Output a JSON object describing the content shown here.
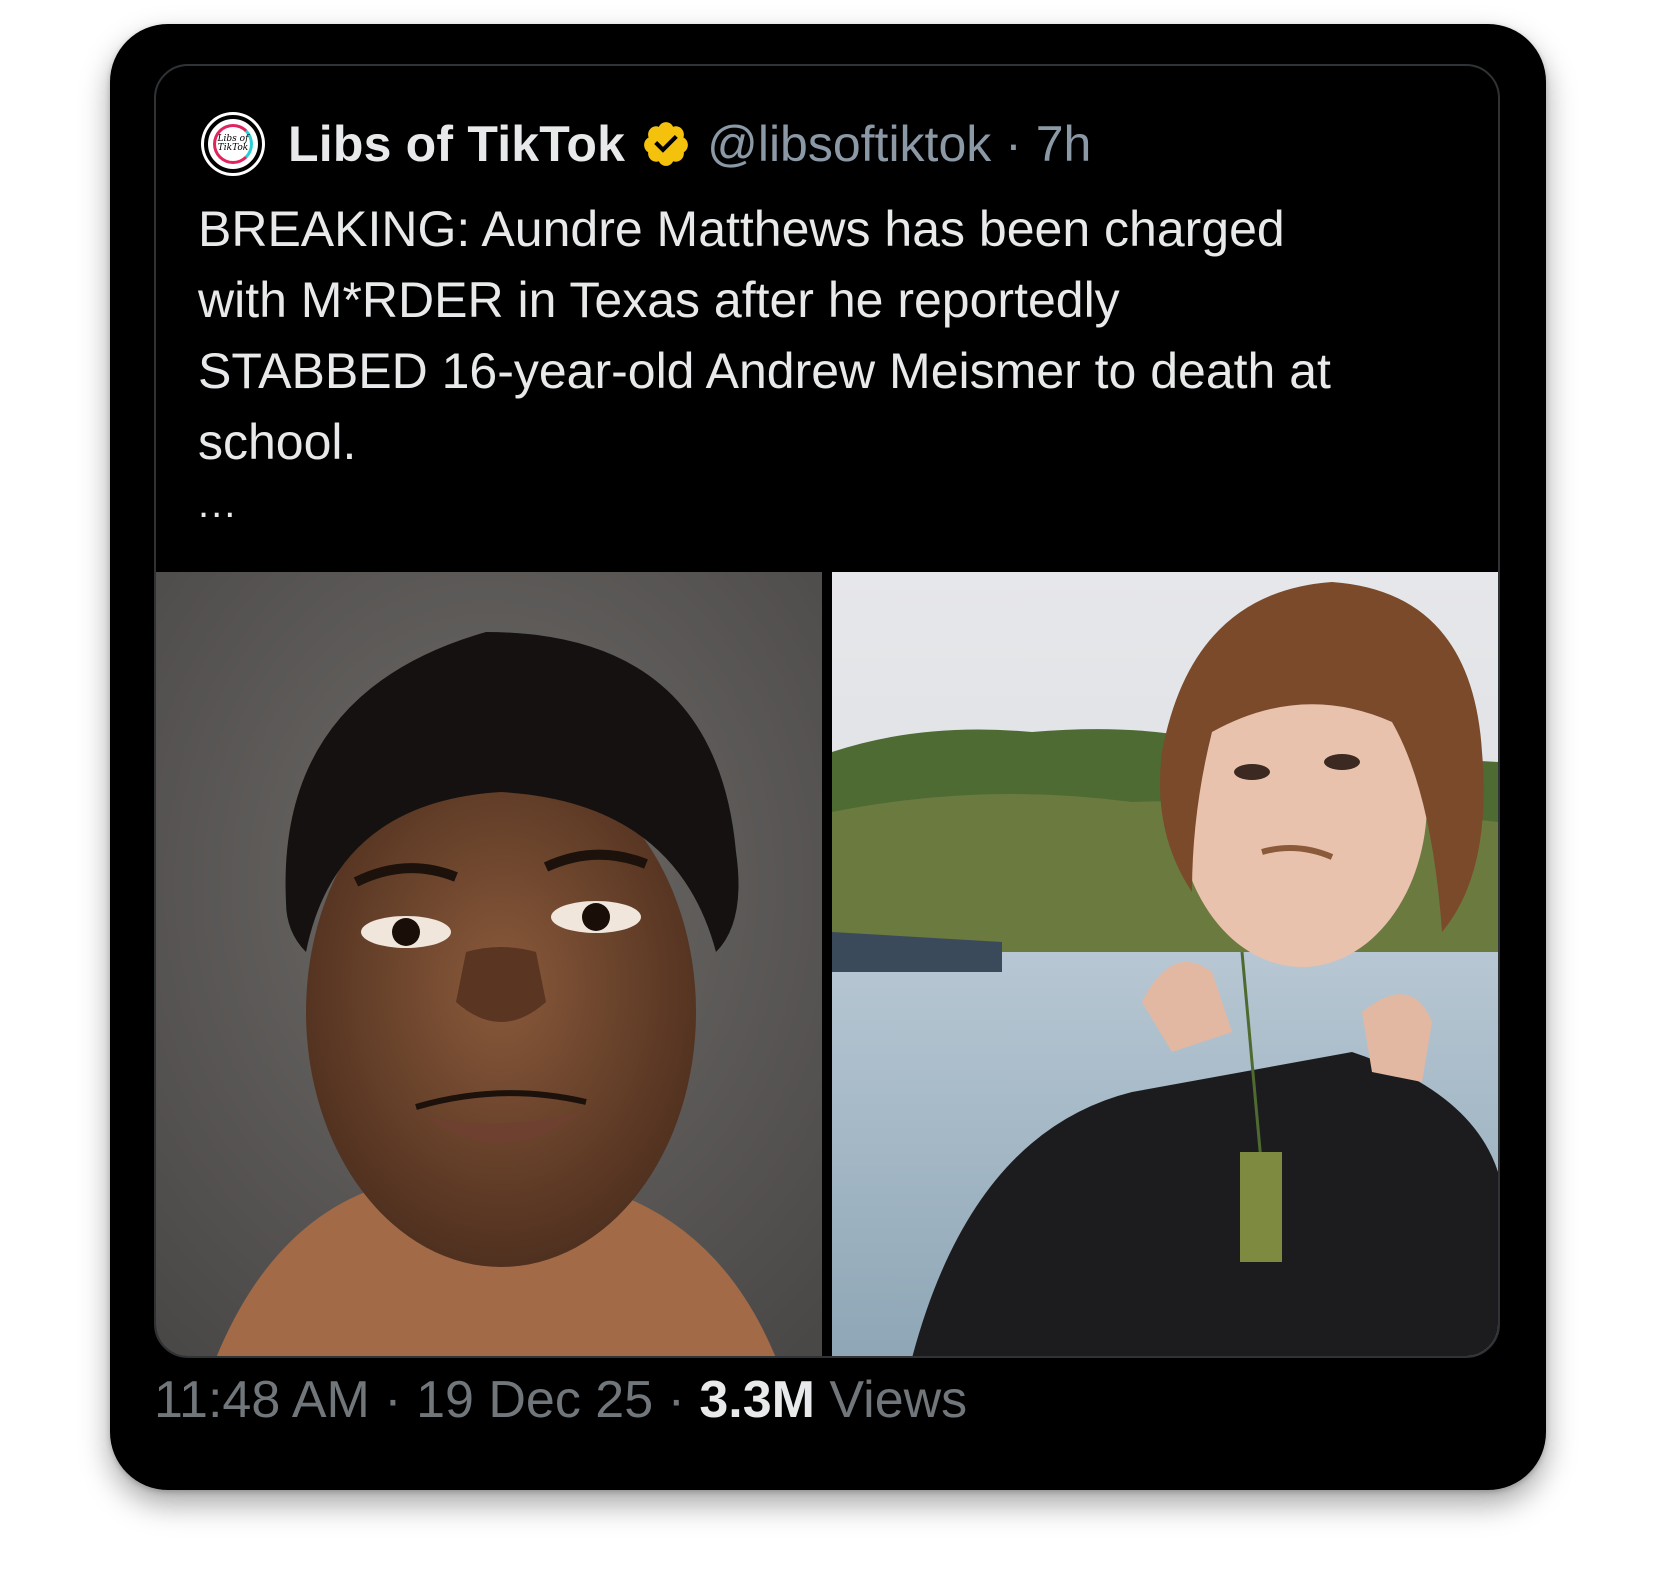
{
  "tweet": {
    "author": {
      "display_name": "Libs of TikTok",
      "handle": "@libsoftiktok",
      "avatar_text": "Libs of TikTok",
      "verified": true,
      "verified_color": "#f4c20d"
    },
    "separator": " · ",
    "age": "7h",
    "text": "BREAKING: Aundre Matthews has been charged\nwith M*RDER in Texas after he reportedly\nSTABBED 16-year-old Andrew Meismer to death at\nschool.",
    "more_indicator": "...",
    "media": [
      {
        "name": "mugshot-photo"
      },
      {
        "name": "lake-portrait-photo"
      }
    ],
    "footer": {
      "time": "11:48 AM",
      "date": "19 Dec 25",
      "views_count": "3.3M",
      "views_label": "Views",
      "separator": " · "
    }
  },
  "colors": {
    "background": "#000000",
    "text": "#e7e9ea",
    "muted": "#71767b",
    "border": "#2f3336"
  }
}
